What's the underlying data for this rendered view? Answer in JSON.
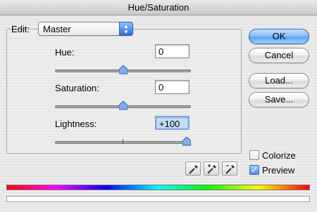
{
  "window": {
    "title": "Hue/Saturation"
  },
  "edit": {
    "label": "Edit:",
    "selected": "Master"
  },
  "hue": {
    "label": "Hue:",
    "value": "0",
    "slider_fraction": 0.5
  },
  "saturation": {
    "label": "Saturation:",
    "value": "0",
    "slider_fraction": 0.5
  },
  "lightness": {
    "label": "Lightness:",
    "value": "+100",
    "slider_fraction": 1.0
  },
  "buttons": {
    "ok": "OK",
    "cancel": "Cancel",
    "load": "Load...",
    "save": "Save..."
  },
  "options": {
    "colorize": {
      "label": "Colorize",
      "checked": false
    },
    "preview": {
      "label": "Preview",
      "checked": true
    }
  },
  "icons": [
    "eyedropper-icon",
    "eyedropper-plus-icon",
    "eyedropper-minus-icon"
  ],
  "colors": {
    "accent": "#5c9ff0"
  }
}
